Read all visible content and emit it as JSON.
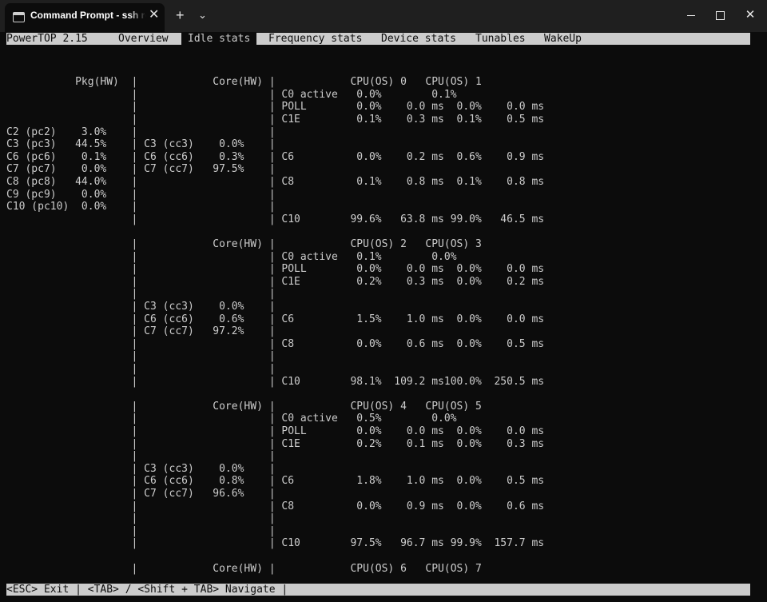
{
  "window": {
    "tab_title": "Command Prompt - ssh  root@",
    "tab_close": "✕",
    "new_tab": "+",
    "dropdown": "⌄",
    "close": "✕"
  },
  "menu": {
    "items": [
      "PowerTOP 2.15",
      "Overview",
      "Idle stats",
      "Frequency stats",
      "Device stats",
      "Tunables",
      "WakeUp"
    ],
    "active": "Idle stats"
  },
  "screen_lines": [
    "",
    "",
    "           Pkg(HW)  |            Core(HW) |            CPU(OS) 0   CPU(OS) 1",
    "                    |                     | C0 active   0.0%        0.1%",
    "                    |                     | POLL        0.0%    0.0 ms  0.0%    0.0 ms",
    "                    |                     | C1E         0.1%    0.3 ms  0.1%    0.5 ms",
    "C2 (pc2)    3.0%    |                     |",
    "C3 (pc3)   44.5%    | C3 (cc3)    0.0%    |",
    "C6 (pc6)    0.1%    | C6 (cc6)    0.3%    | C6          0.0%    0.2 ms  0.6%    0.9 ms",
    "C7 (pc7)    0.0%    | C7 (cc7)   97.5%    |",
    "C8 (pc8)   44.0%    |                     | C8          0.1%    0.8 ms  0.1%    0.8 ms",
    "C9 (pc9)    0.0%    |                     |",
    "C10 (pc10)  0.0%    |                     |",
    "                    |                     | C10        99.6%   63.8 ms 99.0%   46.5 ms",
    "",
    "                    |            Core(HW) |            CPU(OS) 2   CPU(OS) 3",
    "                    |                     | C0 active   0.1%        0.0%",
    "                    |                     | POLL        0.0%    0.0 ms  0.0%    0.0 ms",
    "                    |                     | C1E         0.2%    0.3 ms  0.0%    0.2 ms",
    "                    |                     |",
    "                    | C3 (cc3)    0.0%    |",
    "                    | C6 (cc6)    0.6%    | C6          1.5%    1.0 ms  0.0%    0.0 ms",
    "                    | C7 (cc7)   97.2%    |",
    "                    |                     | C8          0.0%    0.6 ms  0.0%    0.5 ms",
    "                    |                     |",
    "                    |                     |",
    "                    |                     | C10        98.1%  109.2 ms100.0%  250.5 ms",
    "",
    "                    |            Core(HW) |            CPU(OS) 4   CPU(OS) 5",
    "                    |                     | C0 active   0.5%        0.0%",
    "                    |                     | POLL        0.0%    0.0 ms  0.0%    0.0 ms",
    "                    |                     | C1E         0.2%    0.1 ms  0.0%    0.3 ms",
    "                    |                     |",
    "                    | C3 (cc3)    0.0%    |",
    "                    | C6 (cc6)    0.8%    | C6          1.8%    1.0 ms  0.0%    0.5 ms",
    "                    | C7 (cc7)   96.6%    |",
    "                    |                     | C8          0.0%    0.9 ms  0.0%    0.6 ms",
    "                    |                     |",
    "                    |                     |",
    "                    |                     | C10        97.5%   96.7 ms 99.9%  157.7 ms",
    "",
    "                    |            Core(HW) |            CPU(OS) 6   CPU(OS) 7"
  ],
  "status_bar": "<ESC> Exit | <TAB> / <Shift + TAB> Navigate |"
}
